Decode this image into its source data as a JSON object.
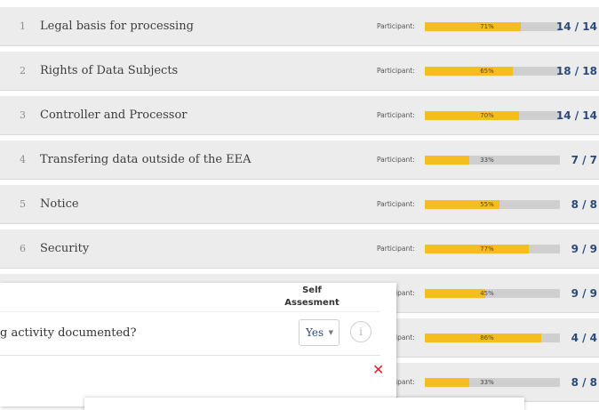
{
  "participant_label": "Participant:",
  "rows": [
    {
      "num": "1",
      "title": "Legal basis for processing",
      "pct": 71,
      "pct_label": "71%",
      "count": "14 / 14"
    },
    {
      "num": "2",
      "title": "Rights of Data Subjects",
      "pct": 65,
      "pct_label": "65%",
      "count": "18 / 18"
    },
    {
      "num": "3",
      "title": "Controller and Processor",
      "pct": 70,
      "pct_label": "70%",
      "count": "14 / 14"
    },
    {
      "num": "4",
      "title": "Transfering data outside of the EEA",
      "pct": 33,
      "pct_label": "33%",
      "count": "7 / 7"
    },
    {
      "num": "5",
      "title": "Notice",
      "pct": 55,
      "pct_label": "55%",
      "count": "8 / 8"
    },
    {
      "num": "6",
      "title": "Security",
      "pct": 77,
      "pct_label": "77%",
      "count": "9 / 9"
    },
    {
      "num": "",
      "title": "",
      "pct": 45,
      "pct_label": "45%",
      "count": "9 / 9"
    },
    {
      "num": "",
      "title": "",
      "pct": 86,
      "pct_label": "86%",
      "count": "4 / 4"
    },
    {
      "num": "",
      "title": "",
      "pct": 33,
      "pct_label": "33%",
      "count": "8 / 8"
    }
  ],
  "popup": {
    "header_line1": "Self",
    "header_line2": "Assesment",
    "question": "g activity documented?",
    "answer": "Yes",
    "info_icon": "info-icon",
    "close_icon": "close-icon",
    "close_glyph": "✕",
    "info_glyph": "i",
    "caret_glyph": "▼"
  },
  "colors": {
    "bar_fill": "#f5bd1f",
    "bar_track": "#cfcfcf",
    "count": "#2b4a7a",
    "row_bg": "#ececec",
    "close": "#d9262e"
  }
}
